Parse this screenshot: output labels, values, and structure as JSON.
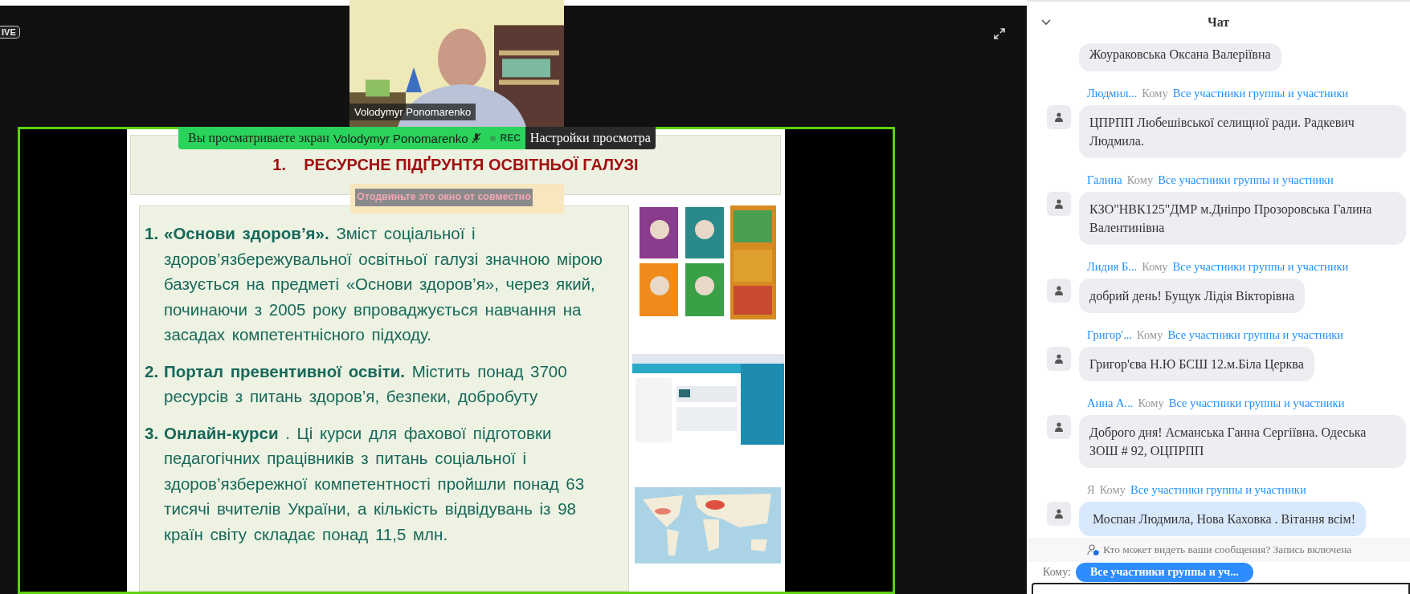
{
  "live_badge": "IVE",
  "video": {
    "kind": "picture",
    "name": "Volodymyr Ponomarenko"
  },
  "share_banner": {
    "prefix": "Вы просматриваете экран",
    "presenter": "Volodymyr Ponomarenko",
    "recording": "REC",
    "settings": "Настройки просмотра"
  },
  "floating_window": {
    "text": "Отодвиньте это окно от совместно"
  },
  "slide": {
    "title": "1.    РЕСУРСНЕ ПІДҐРУНТЯ ОСВІТНЬОЇ ГАЛУЗІ",
    "items": [
      {
        "number": "1.",
        "text": "**«Основи  здоров’я».** Зміст соціальної  і здоров’язбережувальної  освітньої  галузі  значною мірою  базується  на  предметі  «Основи здоров’я», через  який,  починаючи з 2005 року впроваджується навчання  на засадах  компетентнісного  підходу."
      },
      {
        "number": "2.",
        "text": "**Портал превентивної освіти.**  Містить понад 3700 ресурсів з питань здоров’я, безпеки, добробуту"
      },
      {
        "number": "3.",
        "text": "**Онлайн-курси** . Ці курси для фахової  підготовки педагогічних  працівників  з питань соціальної  і здоров’язбережної  компетентності  пройшли понад 63 тисячі вчителів  України, а кількість відвідувань із 98 країн світу складає понад 11,5 млн."
      }
    ],
    "pictures": [
      {
        "kind": "books"
      },
      {
        "kind": "website"
      },
      {
        "kind": "map"
      }
    ]
  },
  "chat": {
    "title": "Чат",
    "messages": [
      {
        "own": false,
        "text": "Жоураковська Оксана Валеріївна"
      },
      {
        "own": false,
        "sender": "Людмил...",
        "to": "Кому",
        "recipients": "Все участники группы и участники",
        "text": "ЦПРПП Любешівської селищної ради. Радкевич Людмила."
      },
      {
        "own": false,
        "sender": "Галина",
        "to": "Кому",
        "recipients": "Все участники группы и участники",
        "text": "КЗО\"НВК125\"ДМР м.Дніпро Прозоровська Галина Валентинівна"
      },
      {
        "own": false,
        "sender": "Лидия Б...",
        "to": "Кому",
        "recipients": "Все участники группы и участники",
        "text": "добрий день! Бущук Лідія Вікторівна"
      },
      {
        "own": false,
        "sender": "Григор'...",
        "to": "Кому",
        "recipients": "Все участники группы и участники",
        "text": "Григор'єва Н.Ю БСШ 12.м.Біла Церква"
      },
      {
        "own": false,
        "sender": "Анна А...",
        "to": "Кому",
        "recipients": "Все участники группы и участники",
        "text": "Доброго дня! Асманська Ганна Сергіївна. Одеська ЗОШ # 92, ОЦПРПП"
      },
      {
        "own": true,
        "sender": "Я",
        "to": "Кому",
        "recipients": "Все участники группы и участники",
        "text": "Моспан Людмила, Нова Каховка . Вітання всім!"
      }
    ],
    "privacy_note": "Кто может видеть ваши сообщения? Запись включена",
    "recipient_label": "Кому:",
    "recipient_button": "Все участники группы и уч..."
  }
}
